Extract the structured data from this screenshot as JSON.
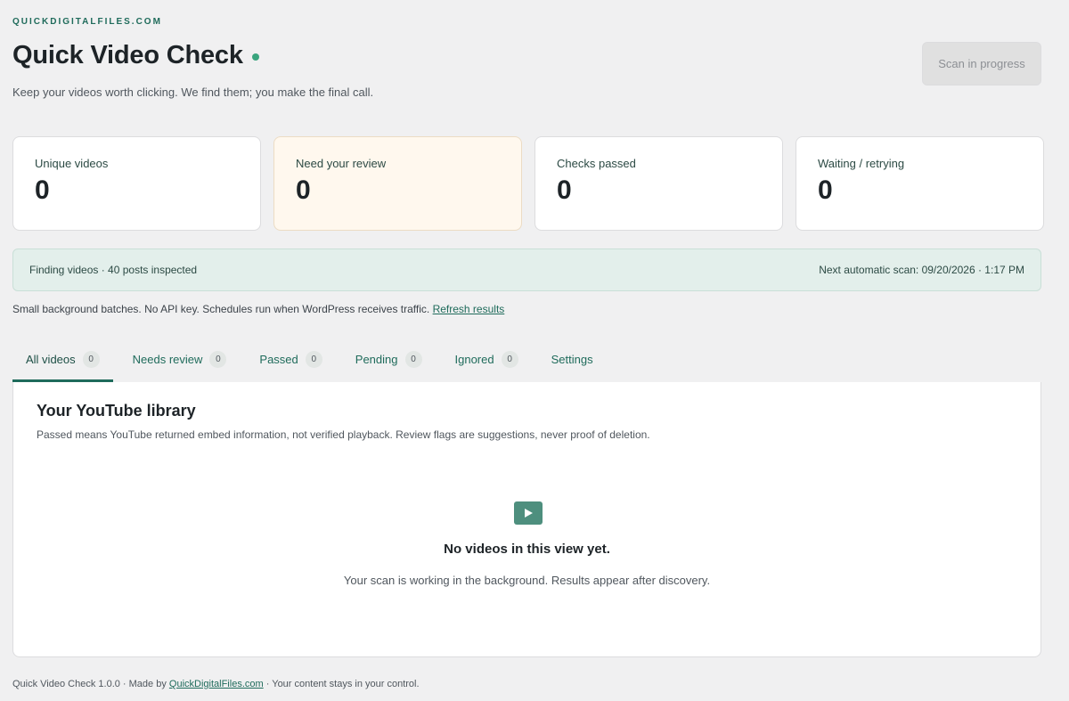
{
  "header": {
    "brand": "QUICKDIGITALFILES.COM",
    "title": "Quick Video Check",
    "subtitle": "Keep your videos worth clicking. We find them; you make the final call.",
    "scan_button": "Scan in progress"
  },
  "stats": [
    {
      "label": "Unique videos",
      "value": "0"
    },
    {
      "label": "Need your review",
      "value": "0"
    },
    {
      "label": "Checks passed",
      "value": "0"
    },
    {
      "label": "Waiting / retrying",
      "value": "0"
    }
  ],
  "progress": {
    "status": "Finding videos · 40 posts inspected",
    "next_scan": "Next automatic scan: 09/20/2026 · 1:17 PM"
  },
  "note": {
    "text": "Small background batches. No API key. Schedules run when WordPress receives traffic.",
    "link": "Refresh results"
  },
  "tabs": [
    {
      "label": "All videos",
      "count": "0"
    },
    {
      "label": "Needs review",
      "count": "0"
    },
    {
      "label": "Passed",
      "count": "0"
    },
    {
      "label": "Pending",
      "count": "0"
    },
    {
      "label": "Ignored",
      "count": "0"
    },
    {
      "label": "Settings"
    }
  ],
  "panel": {
    "title": "Your YouTube library",
    "description": "Passed means YouTube returned embed information, not verified playback. Review flags are suggestions, never proof of deletion.",
    "empty_icon": "play-icon",
    "empty_title": "No videos in this view yet.",
    "empty_description": "Your scan is working in the background. Results appear after discovery."
  },
  "footer": {
    "prefix": "Quick Video Check 1.0.0 · Made by",
    "link": "QuickDigitalFiles.com",
    "suffix": "· Your content stays in your control."
  },
  "colors": {
    "accent": "#1f6b5b",
    "status_dot": "#3aa57e",
    "highlight_card": "#fff8ee",
    "progress_bg": "#e3efeb"
  }
}
